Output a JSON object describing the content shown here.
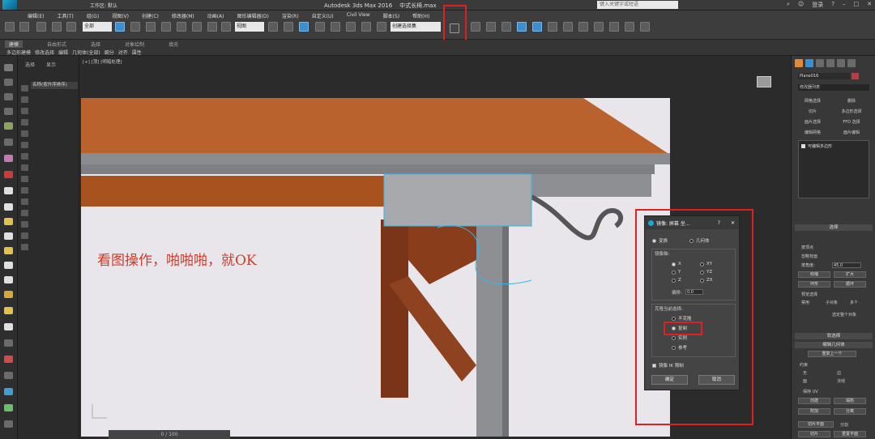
{
  "title_bar": {
    "workspace_label": "工作区: 默认",
    "app_title": "Autodesk 3ds Max 2016",
    "file_name": "中式长椅.max",
    "search_placeholder": "键入关键字或短语",
    "user": "登录",
    "menu": [
      "编辑(E)",
      "工具(T)",
      "组(G)",
      "视图(V)",
      "创建(C)",
      "修改器(M)",
      "动画(A)",
      "图形编辑器(D)",
      "渲染(R)",
      "自定义(U)",
      "Civil View",
      "脚本(S)",
      "帮助(H)"
    ]
  },
  "toolbar": {
    "selection_filter": "全部",
    "ref_coord": "视图",
    "named_selection": "创建选择集",
    "mirror_tool": "mirror-icon"
  },
  "ribbon": {
    "tabs": [
      "建模",
      "自由形式",
      "选择",
      "对象绘制",
      "填充"
    ],
    "sub_items": [
      "多边形建模",
      "修改选择",
      "编辑",
      "几何体(全部)",
      "细分",
      "对齐",
      "属性"
    ]
  },
  "explorer": {
    "tabs": [
      "选择",
      "显示"
    ],
    "column_header": "名称(按升序排序)"
  },
  "viewport": {
    "label": "[+] [顶] [明暗处理]",
    "annotation": "看图操作，啪啪啪，就OK",
    "timeline": "0 / 100",
    "colors": {
      "tabletop": "#b9622e",
      "wood": "#8a3d1b",
      "frame_grey": "#8d8f93",
      "select_outline": "#36b6e8",
      "highlight_red": "#e02020"
    }
  },
  "mirror_dialog": {
    "title": "镜像: 屏幕 坐...",
    "help": "?",
    "close": "✕",
    "mode_options": [
      "变换",
      "几何体"
    ],
    "mode_selected": "变换",
    "axis_group": "镜像轴:",
    "axes": [
      "X",
      "Y",
      "Z",
      "XY",
      "YZ",
      "ZX"
    ],
    "axis_selected": "X",
    "offset_label": "偏移:",
    "offset_value": "0.0",
    "clone_group": "克隆当前选择:",
    "clone_options": [
      "不克隆",
      "复制",
      "实例",
      "参考"
    ],
    "clone_selected": "复制",
    "ik_label": "镜像 IK 限制",
    "ok": "确定",
    "cancel": "取消"
  },
  "command_panel": {
    "object_name": "Plane016",
    "modifier_list": "修改器列表",
    "buttons": [
      "网格选择",
      "删除",
      "切片",
      "多边形选择",
      "面片选择",
      "FFD 选择",
      "编辑网格",
      "面片编辑"
    ],
    "stack_item": "可编辑多边形",
    "selection_section": "选择",
    "selection_opts": [
      "按顶点",
      "忽略背面",
      "按角度:"
    ],
    "angle_value": "45.0",
    "shrink": "收缩",
    "grow": "扩大",
    "ring": "环形",
    "loop": "循环",
    "preview_label": "预览选择",
    "preview_opts": [
      "禁用",
      "子对象",
      "多个"
    ],
    "select_all": "选定整个对象",
    "soft_selection": "软选择",
    "edit_geometry": "编辑几何体",
    "repeat_last": "重复上一个",
    "constraint_label": "约束",
    "constraint_opts": [
      "无",
      "边",
      "面",
      "法线"
    ],
    "preserve_uv": "保持 UV",
    "create": "创建",
    "collapse": "塌陷",
    "attach": "附加",
    "detach": "分离",
    "slice_plane": "切片平面",
    "split": "分割",
    "slice": "切片",
    "reset_plane": "重置平面"
  }
}
